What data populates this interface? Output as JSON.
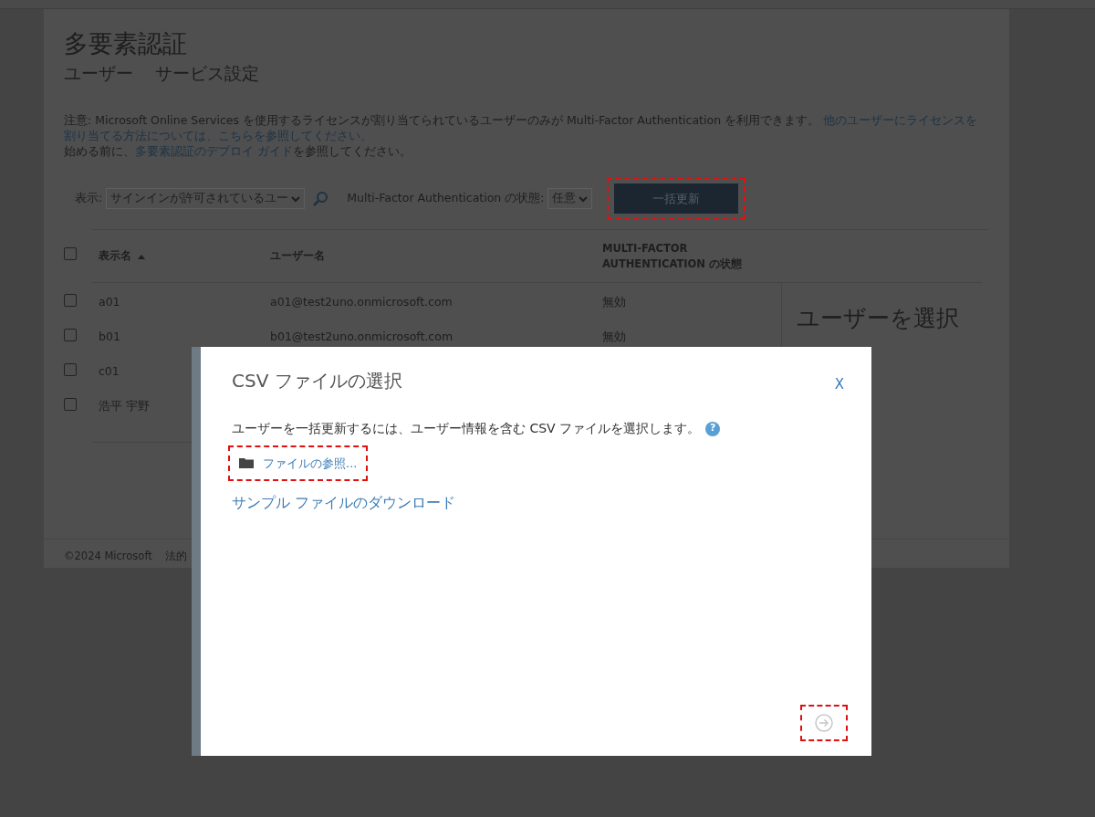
{
  "page": {
    "title": "多要素認証",
    "views": [
      "ユーザー",
      "サービス設定"
    ],
    "notice": {
      "text": "注意: Microsoft Online Services を使用するライセンスが割り当てられているユーザーのみが Multi-Factor Authentication を利用できます。",
      "link_lines": [
        "他のユーザーにライセンスを",
        "割り当てる方法については、こちらを参照してください。"
      ]
    },
    "guide": {
      "before": "始める前に、",
      "link": "多要素認証のデプロイ ガイド",
      "after": "を参照してください。"
    },
    "filters": {
      "view_label": "表示:",
      "view_value": "サインインが許可されているユー",
      "status_label": "Multi-Factor Authentication の状態:",
      "status_value": "任意",
      "bulk_button": {
        "label": "一括更新",
        "highlighted": true
      }
    },
    "table": {
      "select_all_checked": false,
      "columns": [
        "表示名",
        "ユーザー名",
        "MULTI-FACTOR AUTHENTICATION の状態"
      ],
      "rows": [
        {
          "checked": false,
          "display_name": "a01",
          "user_name": "a01@test2uno.onmicrosoft.com",
          "status": "無効"
        },
        {
          "checked": false,
          "display_name": "b01",
          "user_name": "b01@test2uno.onmicrosoft.com",
          "status": "無効"
        },
        {
          "checked": false,
          "display_name": "c01"
        },
        {
          "checked": false,
          "display_name": "浩平 宇野"
        }
      ]
    },
    "side_panel": "ユーザーを選択",
    "footer": [
      "©2024 Microsoft",
      "法的"
    ]
  },
  "dialog": {
    "title": "CSV ファイルの選択",
    "close": "X",
    "description": "ユーザーを一括更新するには、ユーザー情報を含む CSV ファイルを選択します。",
    "help": "?",
    "browse": {
      "label": "ファイルの参照...",
      "highlighted": true
    },
    "sample_link": "サンプル ファイルのダウンロード",
    "next": {
      "disabled": true,
      "highlighted": true
    }
  }
}
